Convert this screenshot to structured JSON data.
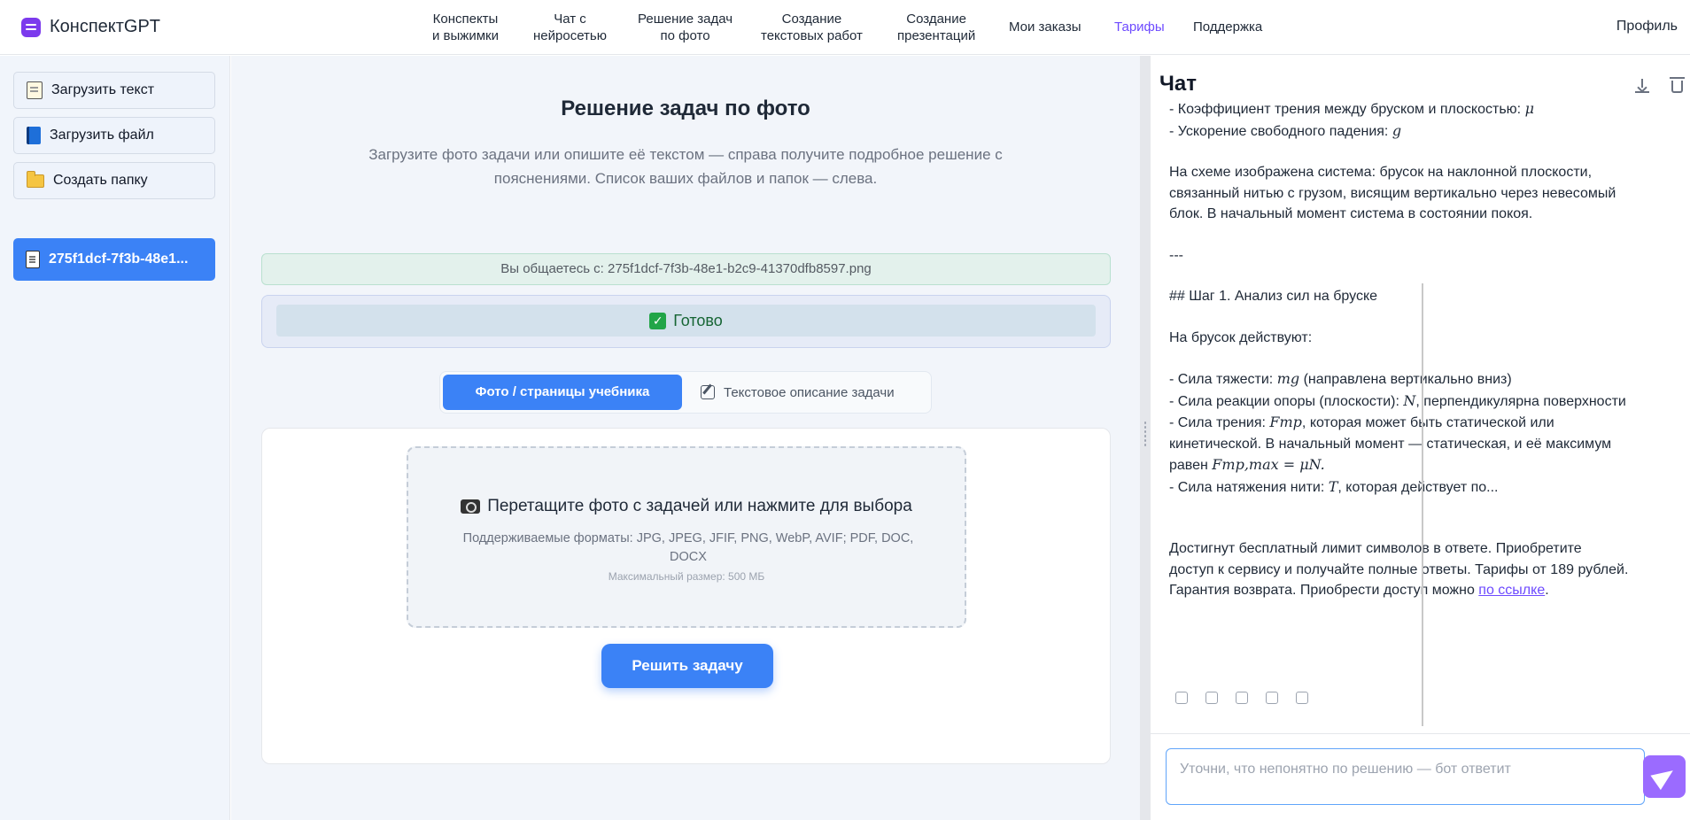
{
  "app": {
    "title": "КонспектGPT"
  },
  "nav": [
    {
      "line1": "Конспекты",
      "line2": "и выжимки"
    },
    {
      "line1": "Чат с",
      "line2": "нейросетью"
    },
    {
      "line1": "Решение задач",
      "line2": "по фото"
    },
    {
      "line1": "Создание",
      "line2": "текстовых работ"
    },
    {
      "line1": "Создание",
      "line2": "презентаций"
    },
    {
      "line1": "Мои заказы",
      "line2": ""
    },
    {
      "line1": "Тарифы",
      "line2": ""
    },
    {
      "line1": "Поддержка",
      "line2": ""
    }
  ],
  "profile": "Профиль",
  "sidebar": {
    "upload_text": "Загрузить текст",
    "upload_file": "Загрузить файл",
    "create_folder": "Создать папку",
    "file_name": "275f1dcf-7f3b-48e1..."
  },
  "main": {
    "title": "Решение задач по фото",
    "subtitle": "Загрузите фото задачи или опишите её текстом — справа получите подробное решение с пояснениями. Список ваших файлов и папок — слева.",
    "chat_with": "Вы общаетесь с: 275f1dcf-7f3b-48e1-b2c9-41370dfb8597.png",
    "status": "Готово",
    "tab_photo": "Фото / страницы учебника",
    "tab_text": "Текстовое описание задачи",
    "dropzone_title": "Перетащите фото с задачей или нажмите для выбора",
    "dropzone_formats": "Поддерживаемые форматы: JPG, JPEG, JFIF, PNG, WebP, AVIF; PDF, DOC, DOCX",
    "dropzone_max": "Максимальный размер: 500 МБ",
    "solve_button": "Решить задачу"
  },
  "chat": {
    "title": "Чат",
    "lines": {
      "l1a": "- Коэффициент трения между бруском и плоскостью: ",
      "l1m": "μ",
      "l2a": "- Ускорение свободного падения: ",
      "l2m": "g",
      "p1": "На схеме изображена система: брусок на наклонной плоскости, связанный нитью с грузом, висящим вертикально через невесомый блок. В начальный момент система в состоянии покоя.",
      "sep": "---",
      "h1": "## Шаг 1. Анализ сил на бруске",
      "p2": "На брусок действуют:",
      "f1a": "- Сила тяжести: ",
      "f1m": "mg",
      "f1b": " (направлена вертикально вниз)",
      "f2a": "- Сила реакции опоры (плоскости): ",
      "f2m": "N",
      "f2b": ", перпендикулярна поверхности",
      "f3a": "- Сила трения: ",
      "f3m": "Fтр",
      "f3b": ", которая может быть статической или кинетической. В начальный момент — статическая, и её максимум равен ",
      "f3m2": "Fтр,max = μN.",
      "f4a": "- Сила натяжения нити: ",
      "f4m": "T",
      "f4b": ", которая действует по...",
      "limit": "Достигнут бесплатный лимит символов в ответе. Приобретите доступ к сервису и получайте полные ответы. Тарифы от 189 рублей. Гарантия возврата. Приобрести доступ можно ",
      "link": "по ссылке",
      "dot": "."
    },
    "input_placeholder": "Уточни, что непонятно по решению — бот ответит"
  },
  "colors": {
    "accent": "#3b82f6",
    "brand": "#7c3aed",
    "active_nav": "#6d4aff",
    "success": "#166534"
  },
  "icons": [
    "notepad-icon",
    "book-icon",
    "folder-icon",
    "document-icon",
    "camera-icon",
    "pencil-icon",
    "download-icon",
    "trash-icon",
    "send-icon",
    "copy-icon",
    "like-icon",
    "dislike-icon"
  ]
}
